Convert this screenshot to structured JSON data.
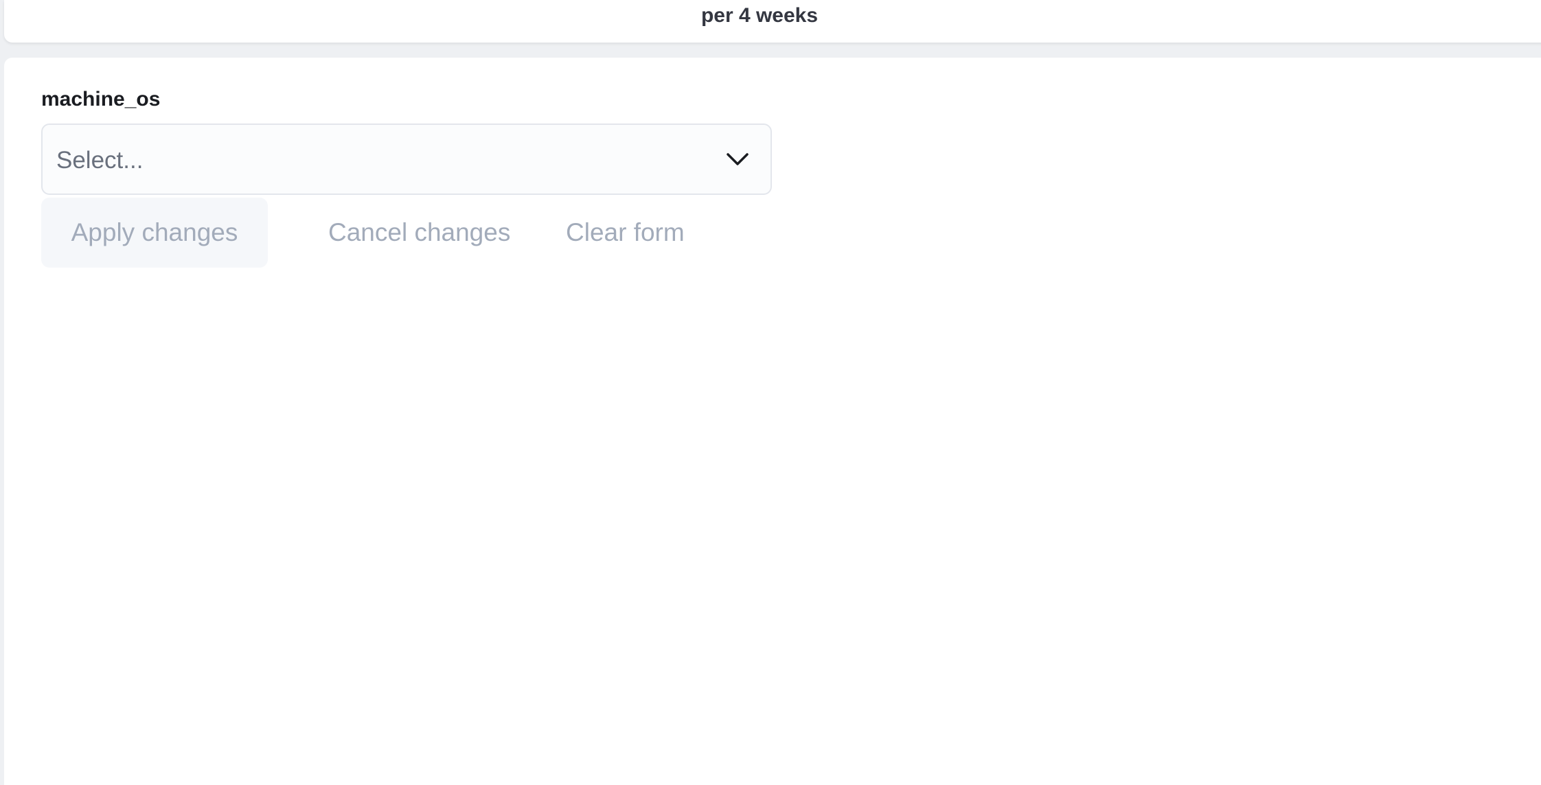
{
  "header": {
    "caption": "per 4 weeks"
  },
  "form": {
    "field_label": "machine_os",
    "select": {
      "placeholder": "Select...",
      "icon": "chevron-down-icon"
    },
    "buttons": {
      "apply": "Apply changes",
      "cancel": "Cancel changes",
      "clear": "Clear form"
    }
  },
  "colors": {
    "background": "#eef0f3",
    "card": "#ffffff",
    "disabled_text": "#a2abba",
    "label_text": "#1a1c21"
  }
}
